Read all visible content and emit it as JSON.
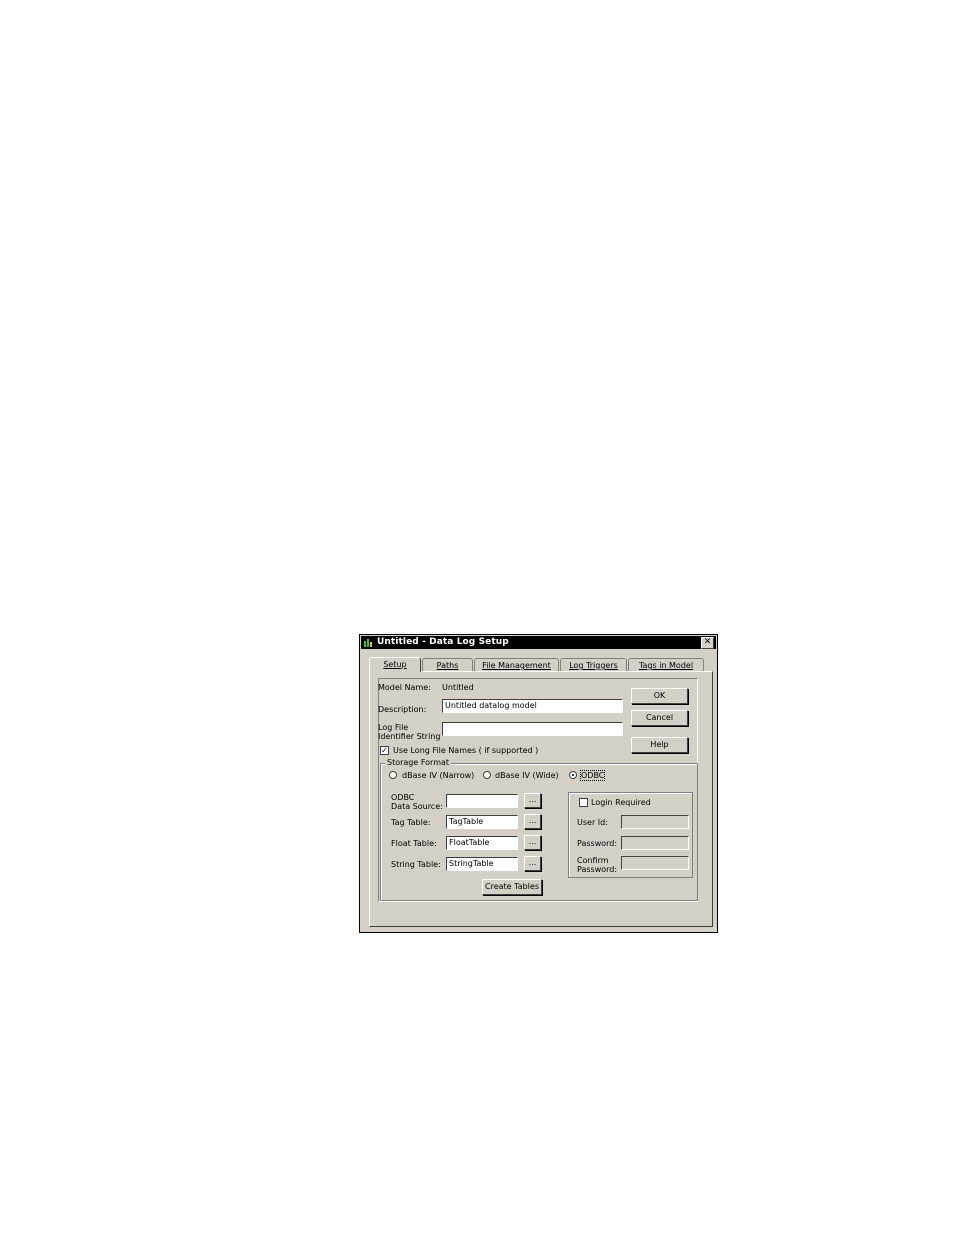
{
  "window": {
    "title": "Untitled - Data Log Setup",
    "close_glyph": "✕"
  },
  "tabs": [
    {
      "label": "Setup",
      "active": true
    },
    {
      "label": "Paths",
      "active": false
    },
    {
      "label": "File Management",
      "active": false
    },
    {
      "label": "Log Triggers",
      "active": false
    },
    {
      "label": "Tags in Model",
      "active": false
    }
  ],
  "setup": {
    "model_name_label": "Model Name:",
    "model_name_value": "Untitled",
    "description_label": "Description:",
    "description_value": "Untitled datalog model",
    "log_file_label_1": "Log File",
    "log_file_label_2": "Identifier String",
    "log_file_value": "",
    "long_names_label": "Use Long File Names ( if supported )",
    "long_names_checked": true
  },
  "buttons": {
    "ok": "OK",
    "cancel": "Cancel",
    "help": "Help"
  },
  "storage": {
    "legend": "Storage Format",
    "options": [
      {
        "label": "dBase IV (Narrow)",
        "checked": false
      },
      {
        "label": "dBase IV (Wide)",
        "checked": false
      },
      {
        "label": "ODBC",
        "checked": true
      }
    ]
  },
  "odbc": {
    "data_source_label_1": "ODBC",
    "data_source_label_2": "Data Source:",
    "data_source_value": "",
    "tag_table_label": "Tag Table:",
    "tag_table_value": "TagTable",
    "float_table_label": "Float Table:",
    "float_table_value": "FloatTable",
    "string_table_label": "String Table:",
    "string_table_value": "StringTable",
    "browse_label": "...",
    "create_tables_label": "Create Tables"
  },
  "login": {
    "required_label": "Login Required",
    "required_checked": false,
    "user_id_label": "User Id:",
    "password_label": "Password:",
    "confirm_label_1": "Confirm",
    "confirm_label_2": "Password:"
  }
}
